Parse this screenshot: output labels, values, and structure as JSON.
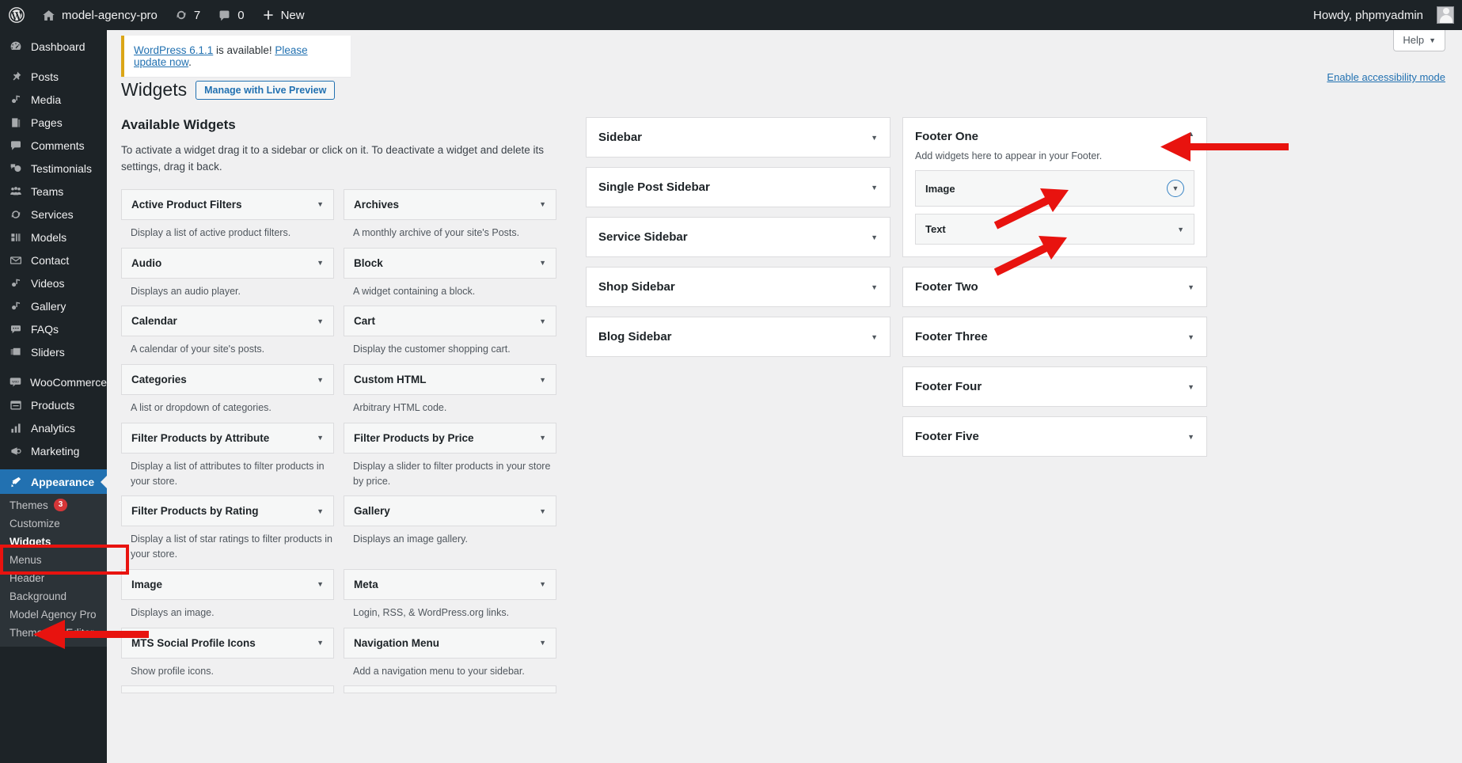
{
  "adminbar": {
    "wp_logo": "wordpress-logo",
    "site_name": "model-agency-pro",
    "updates_count": "7",
    "comments_count": "0",
    "new_label": "New",
    "howdy": "Howdy, phpmyadmin"
  },
  "sidebar": {
    "items": [
      {
        "label": "Dashboard",
        "icon": "dashboard-icon",
        "sep_after": true
      },
      {
        "label": "Posts",
        "icon": "pin-icon"
      },
      {
        "label": "Media",
        "icon": "media-icon"
      },
      {
        "label": "Pages",
        "icon": "page-icon"
      },
      {
        "label": "Comments",
        "icon": "comment-icon"
      },
      {
        "label": "Testimonials",
        "icon": "testimonial-icon"
      },
      {
        "label": "Teams",
        "icon": "groups-icon"
      },
      {
        "label": "Services",
        "icon": "services-icon"
      },
      {
        "label": "Models",
        "icon": "models-icon"
      },
      {
        "label": "Contact",
        "icon": "email-icon"
      },
      {
        "label": "Videos",
        "icon": "video-icon"
      },
      {
        "label": "Gallery",
        "icon": "gallery-icon"
      },
      {
        "label": "FAQs",
        "icon": "faq-icon"
      },
      {
        "label": "Sliders",
        "icon": "sliders-icon",
        "sep_after": true
      },
      {
        "label": "WooCommerce",
        "icon": "woocommerce-icon"
      },
      {
        "label": "Products",
        "icon": "products-icon"
      },
      {
        "label": "Analytics",
        "icon": "analytics-icon"
      },
      {
        "label": "Marketing",
        "icon": "marketing-icon",
        "sep_after": true
      }
    ],
    "appearance": {
      "label": "Appearance",
      "icon": "appearance-icon"
    },
    "submenu": [
      {
        "label": "Themes",
        "badge": "3"
      },
      {
        "label": "Customize"
      },
      {
        "label": "Widgets",
        "active": true
      },
      {
        "label": "Menus"
      },
      {
        "label": "Header"
      },
      {
        "label": "Background"
      },
      {
        "label": "Model Agency Pro"
      },
      {
        "label": "Theme File Editor"
      }
    ]
  },
  "header": {
    "help_label": "Help",
    "notice_link_1": "WordPress 6.1.1",
    "notice_mid": " is available! ",
    "notice_link_2": "Please update now",
    "notice_end": ".",
    "page_title": "Widgets",
    "live_preview_label": "Manage with Live Preview",
    "accessibility_label": "Enable accessibility mode"
  },
  "available": {
    "heading": "Available Widgets",
    "intro": "To activate a widget drag it to a sidebar or click on it. To deactivate a widget and delete its settings, drag it back.",
    "widgets": [
      {
        "name": "Active Product Filters",
        "desc": "Display a list of active product filters."
      },
      {
        "name": "Archives",
        "desc": "A monthly archive of your site's Posts."
      },
      {
        "name": "Audio",
        "desc": "Displays an audio player."
      },
      {
        "name": "Block",
        "desc": "A widget containing a block."
      },
      {
        "name": "Calendar",
        "desc": "A calendar of your site's posts."
      },
      {
        "name": "Cart",
        "desc": "Display the customer shopping cart."
      },
      {
        "name": "Categories",
        "desc": "A list or dropdown of categories."
      },
      {
        "name": "Custom HTML",
        "desc": "Arbitrary HTML code."
      },
      {
        "name": "Filter Products by Attribute",
        "desc": "Display a list of attributes to filter products in your store."
      },
      {
        "name": "Filter Products by Price",
        "desc": "Display a slider to filter products in your store by price."
      },
      {
        "name": "Filter Products by Rating",
        "desc": "Display a list of star ratings to filter products in your store."
      },
      {
        "name": "Gallery",
        "desc": "Displays an image gallery."
      },
      {
        "name": "Image",
        "desc": "Displays an image."
      },
      {
        "name": "Meta",
        "desc": "Login, RSS, & WordPress.org links."
      },
      {
        "name": "MTS Social Profile Icons",
        "desc": "Show profile icons."
      },
      {
        "name": "Navigation Menu",
        "desc": "Add a navigation menu to your sidebar."
      }
    ]
  },
  "sidebars": [
    {
      "title": "Sidebar"
    },
    {
      "title": "Single Post Sidebar"
    },
    {
      "title": "Service Sidebar"
    },
    {
      "title": "Shop Sidebar"
    },
    {
      "title": "Blog Sidebar"
    }
  ],
  "footers": [
    {
      "title": "Footer One",
      "desc": "Add widgets here to appear in your Footer.",
      "expanded": true,
      "widgets": [
        {
          "name": "Image",
          "focused": true
        },
        {
          "name": "Text",
          "focused": false
        }
      ]
    },
    {
      "title": "Footer Two",
      "expanded": false
    },
    {
      "title": "Footer Three",
      "expanded": false
    },
    {
      "title": "Footer Four",
      "expanded": false
    },
    {
      "title": "Footer Five",
      "expanded": false
    }
  ],
  "colors": {
    "admin_bg": "#1d2327",
    "accent_blue": "#2271b1",
    "annotation_red": "#e8130f",
    "notice_yellow": "#dba617",
    "badge_red": "#d63638"
  }
}
